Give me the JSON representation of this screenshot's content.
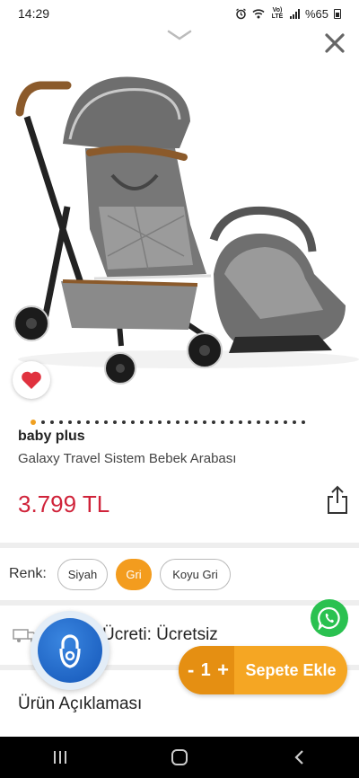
{
  "status": {
    "time": "14:29",
    "net": "Vo) LTE",
    "battery": "%65"
  },
  "product": {
    "brand": "baby plus",
    "name": "Galaxy Travel Sistem Bebek Arabası",
    "price": "3.799 TL",
    "image_slides": 31,
    "active_slide": 0
  },
  "colors": {
    "label": "Renk:",
    "options": [
      "Siyah",
      "Gri",
      "Koyu Gri"
    ],
    "selected": "Gri",
    "accent": "#f39c1e",
    "price": "#d0233a"
  },
  "shipping": {
    "text": "Ücreti:  Ücretsiz"
  },
  "description": {
    "title": "Ürün Açıklaması"
  },
  "cart": {
    "minus": "-",
    "qty": "1",
    "plus": "+",
    "add_label": "Sepete Ekle"
  },
  "icons": [
    "chevron-down-icon",
    "close-icon",
    "heart-icon",
    "share-icon",
    "truck-icon",
    "whatsapp-icon",
    "security-badge-icon",
    "recents-icon",
    "home-icon",
    "back-icon"
  ]
}
